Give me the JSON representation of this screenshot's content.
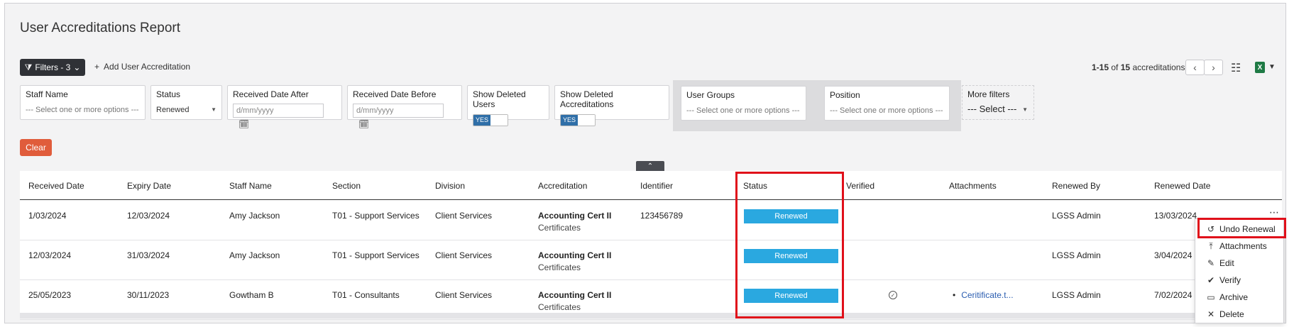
{
  "page": {
    "title": "User Accreditations Report"
  },
  "toolbar": {
    "filters_label": "Filters - 3",
    "add_label": "Add User Accreditation",
    "pager_range": "1-15",
    "pager_of": "of",
    "pager_total": "15",
    "pager_unit": "accreditations"
  },
  "filters": {
    "staff_name": {
      "label": "Staff Name",
      "placeholder": "--- Select one or more options ---"
    },
    "status": {
      "label": "Status",
      "value": "Renewed"
    },
    "received_after": {
      "label": "Received Date After",
      "placeholder": "d/mm/yyyy"
    },
    "received_before": {
      "label": "Received Date Before",
      "placeholder": "d/mm/yyyy"
    },
    "show_deleted_users": {
      "label": "Show Deleted Users",
      "toggle": "YES"
    },
    "show_deleted_accreditations": {
      "label": "Show Deleted Accreditations",
      "toggle": "YES"
    },
    "user_groups": {
      "label": "User Groups",
      "placeholder": "--- Select one or more options ---"
    },
    "position": {
      "label": "Position",
      "placeholder": "--- Select one or more options ---"
    },
    "more_filters": {
      "label": "More filters",
      "placeholder": "--- Select ---"
    },
    "clear_label": "Clear"
  },
  "table": {
    "columns": [
      "Received Date",
      "Expiry Date",
      "Staff Name",
      "Section",
      "Division",
      "Accreditation",
      "Identifier",
      "Status",
      "Verified",
      "Attachments",
      "Renewed By",
      "Renewed Date"
    ],
    "rows": [
      {
        "received": "1/03/2024",
        "expiry": "12/03/2024",
        "staff": "Amy Jackson",
        "section": "T01 - Support Services",
        "division": "Client Services",
        "accreditation": "Accounting Cert II",
        "category": "Certificates",
        "identifier": "123456789",
        "status": "Renewed",
        "verified": "",
        "attachment": "",
        "renewed_by": "LGSS Admin",
        "renewed_date": "13/03/2024"
      },
      {
        "received": "12/03/2024",
        "expiry": "31/03/2024",
        "staff": "Amy Jackson",
        "section": "T01 - Support Services",
        "division": "Client Services",
        "accreditation": "Accounting Cert II",
        "category": "Certificates",
        "identifier": "",
        "status": "Renewed",
        "verified": "",
        "attachment": "",
        "renewed_by": "LGSS Admin",
        "renewed_date": "3/04/2024"
      },
      {
        "received": "25/05/2023",
        "expiry": "30/11/2023",
        "staff": "Gowtham B",
        "section": "T01 - Consultants",
        "division": "Client Services",
        "accreditation": "Accounting Cert II",
        "category": "Certificates",
        "identifier": "",
        "status": "Renewed",
        "verified": "check",
        "attachment": "Ceritificate.t...",
        "renewed_by": "LGSS Admin",
        "renewed_date": "7/02/2024"
      }
    ]
  },
  "row_menu": {
    "items": [
      {
        "label": "Undo Renewal",
        "icon": "undo-icon"
      },
      {
        "label": "Attachments",
        "icon": "attachment-icon"
      },
      {
        "label": "Edit",
        "icon": "pencil-icon"
      },
      {
        "label": "Verify",
        "icon": "check-circle-icon"
      },
      {
        "label": "Archive",
        "icon": "archive-icon"
      },
      {
        "label": "Delete",
        "icon": "x-icon"
      }
    ]
  },
  "colors": {
    "status_badge": "#2aa8e0",
    "highlight": "#e0101a",
    "clear_button": "#e05c3b",
    "toggle_on": "#2f6fa8"
  }
}
